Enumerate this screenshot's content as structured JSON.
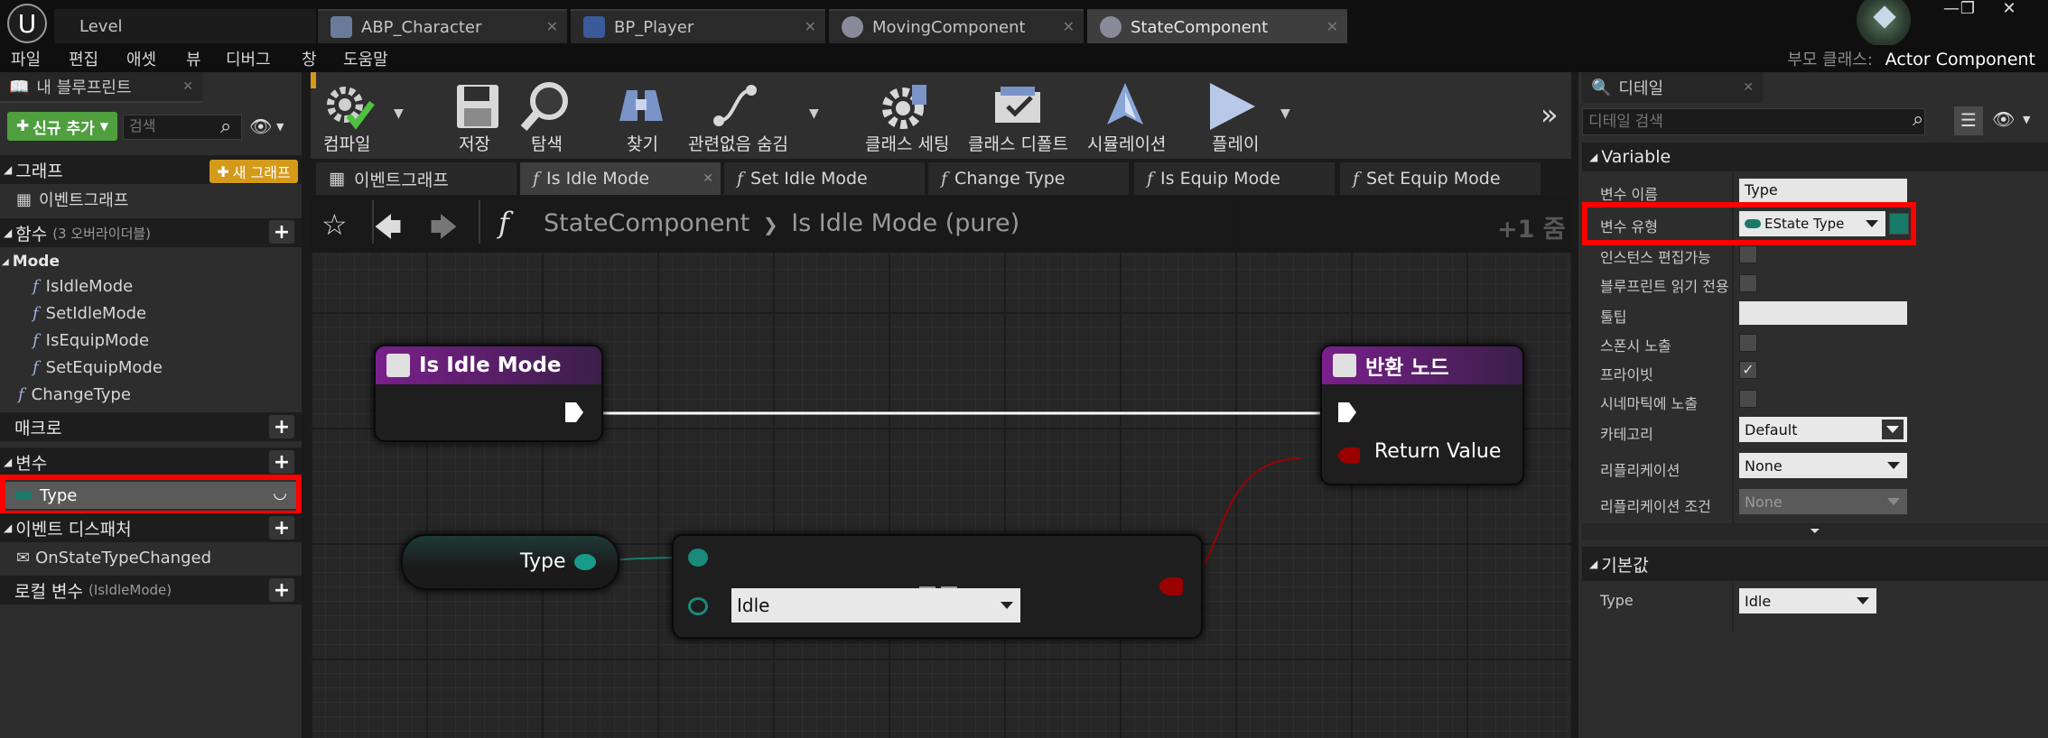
{
  "tabs": [
    {
      "label": "Level"
    },
    {
      "label": "ABP_Character"
    },
    {
      "label": "BP_Player"
    },
    {
      "label": "MovingComponent"
    },
    {
      "label": "StateComponent"
    }
  ],
  "window_buttons": {
    "minimize": "—",
    "maximize": "❐",
    "close": "✕"
  },
  "menu": [
    "파일",
    "편집",
    "애셋",
    "뷰",
    "디버그",
    "창",
    "도움말"
  ],
  "parent_class": {
    "label": "부모 클래스:",
    "value": "Actor Component"
  },
  "left": {
    "tab": "내 블루프린트",
    "add_button": "신규 추가",
    "search_placeholder": "검색",
    "graph_section": "그래프",
    "new_graph": "새 그래프",
    "event_graph": "이벤트그래프",
    "functions_section": "함수",
    "functions_note": "(3 오버라이더블)",
    "mode_category": "Mode",
    "functions": [
      "IsIdleMode",
      "SetIdleMode",
      "IsEquipMode",
      "SetEquipMode",
      "ChangeType"
    ],
    "macros_section": "매크로",
    "variables_section": "변수",
    "variable": "Type",
    "dispatchers_section": "이벤트 디스패처",
    "dispatcher": "OnStateTypeChanged",
    "local_vars_section": "로컬 변수",
    "local_vars_note": "(IsIdleMode)"
  },
  "toolbar": {
    "compile": "컴파일",
    "save": "저장",
    "browse": "탐색",
    "find": "찾기",
    "hide_unrelated": "관련없음 숨김",
    "class_settings": "클래스 세팅",
    "class_defaults": "클래스 디폴트",
    "simulation": "시뮬레이션",
    "play": "플레이"
  },
  "graph_tabs": [
    "이벤트그래프",
    "Is Idle Mode",
    "Set Idle Mode",
    "Change Type",
    "Is Equip Mode",
    "Set Equip Mode"
  ],
  "breadcrumb": {
    "root": "StateComponent",
    "separator": "❯",
    "current": "Is Idle Mode (pure)",
    "zoom": "+1 줌"
  },
  "nodes": {
    "entry_title": "Is Idle Mode",
    "return_title": "반환 노드",
    "return_value": "Return Value",
    "get_type": "Type",
    "equal_enum_value": "Idle"
  },
  "right": {
    "tab": "디테일",
    "search_placeholder": "디테일 검색",
    "variable_section": "Variable",
    "labels": {
      "name": "변수 이름",
      "type": "변수 유형",
      "instance_editable": "인스턴스 편집가능",
      "bp_readonly": "블루프린트 읽기 전용",
      "tooltip": "툴팁",
      "expose_spawn": "스폰시 노출",
      "private": "프라이빗",
      "expose_cinematics": "시네마틱에 노출",
      "category": "카테고리",
      "replication": "리플리케이션",
      "replication_condition": "리플리케이션 조건"
    },
    "values": {
      "name": "Type",
      "type": "EState Type",
      "category": "Default",
      "replication": "None",
      "replication_condition": "None"
    },
    "default_section": "기본값",
    "default_label": "Type",
    "default_value": "Idle"
  },
  "colors": {
    "highlight": "#ff0000",
    "enum_pin": "#1a7a6a",
    "bool_pin": "#9b0000",
    "function_header": "#7a1f8c"
  }
}
